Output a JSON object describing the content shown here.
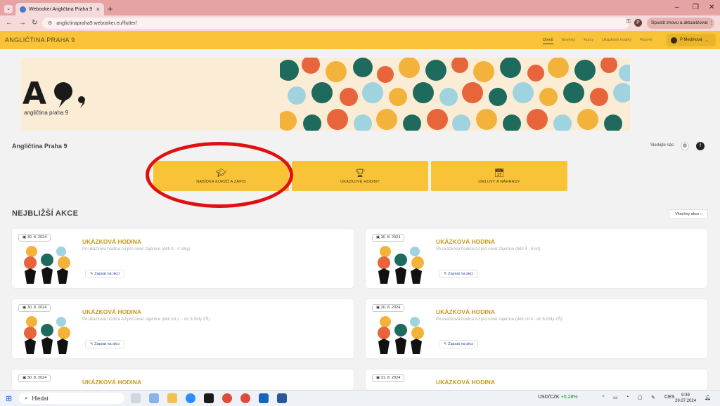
{
  "browser": {
    "tab_title": "Webooker Angličtina Praha 9",
    "url": "anglictinapraha9.webooker.eu/flutter/",
    "update_button": "Spustit znovu a aktualizovat",
    "profile_initial": "P"
  },
  "app": {
    "brand": "ANGLIČTINA PRAHA 9",
    "nav": [
      "Domů",
      "Novinky",
      "Kurzy",
      "Ukázkové hodiny",
      "Rozvrh"
    ],
    "user": "P Medinová"
  },
  "banner": {
    "logo_letters": "A",
    "logo_sub": "angličtina praha 9"
  },
  "page": {
    "title": "Angličtina Praha 9",
    "follow_label": "Sledujte nás:"
  },
  "actions": [
    {
      "label": "NABÍDKA KURZŮ A ZÁPIS",
      "icon": "graduation-cap-icon"
    },
    {
      "label": "UKÁZKOVÉ HODINY",
      "icon": "trophy-icon"
    },
    {
      "label": "OMLUVY A NÁHRADY",
      "icon": "calendar-check-icon"
    }
  ],
  "section": {
    "title": "NEJBLIŽŠÍ AKCE",
    "all_button": "Všechny akce"
  },
  "events": [
    {
      "date": "30. 8. 2024",
      "title": "UKÁZKOVÁ HODINA",
      "desc": "PA ukázková hodina AJ pro nové zájemce (děti 3 - 4 roky)",
      "button": "Zapsat na akci"
    },
    {
      "date": "30. 8. 2024",
      "title": "UKÁZKOVÁ HODINA",
      "desc": "PA ukázková hodina AJ pro nové zájemce (děti 4 - 6 let)",
      "button": "Zapsat na akci"
    },
    {
      "date": "30. 8. 2024",
      "title": "UKÁZKOVÁ HODINA",
      "desc": "PA ukázková hodina AJ pro nové zájemce (děti od 1. - do 3.třídy ZŠ)",
      "button": "Zapsat na akci"
    },
    {
      "date": "30. 8. 2024",
      "title": "UKÁZKOVÁ HODINA",
      "desc": "PA ukázková hodina AJ pro nové zájemce (děti od 4 - do 6.třídy ZŠ)",
      "button": "Zapsat na akci"
    },
    {
      "date": "30. 8. 2024",
      "title": "UKÁZKOVÁ HODINA",
      "desc": "",
      "button": ""
    },
    {
      "date": "31. 8. 2024",
      "title": "UKÁZKOVÁ HODINA",
      "desc": "",
      "button": ""
    }
  ],
  "taskbar": {
    "search": "Hledat",
    "currency": "USD/CZK",
    "currency_change": "+0,28%",
    "lang": "CES",
    "time": "9:39",
    "date": "29.07.2024"
  },
  "colors": {
    "brand_yellow": "#f8c337",
    "title_gold": "#c89a20",
    "annotation_red": "#e01010"
  }
}
